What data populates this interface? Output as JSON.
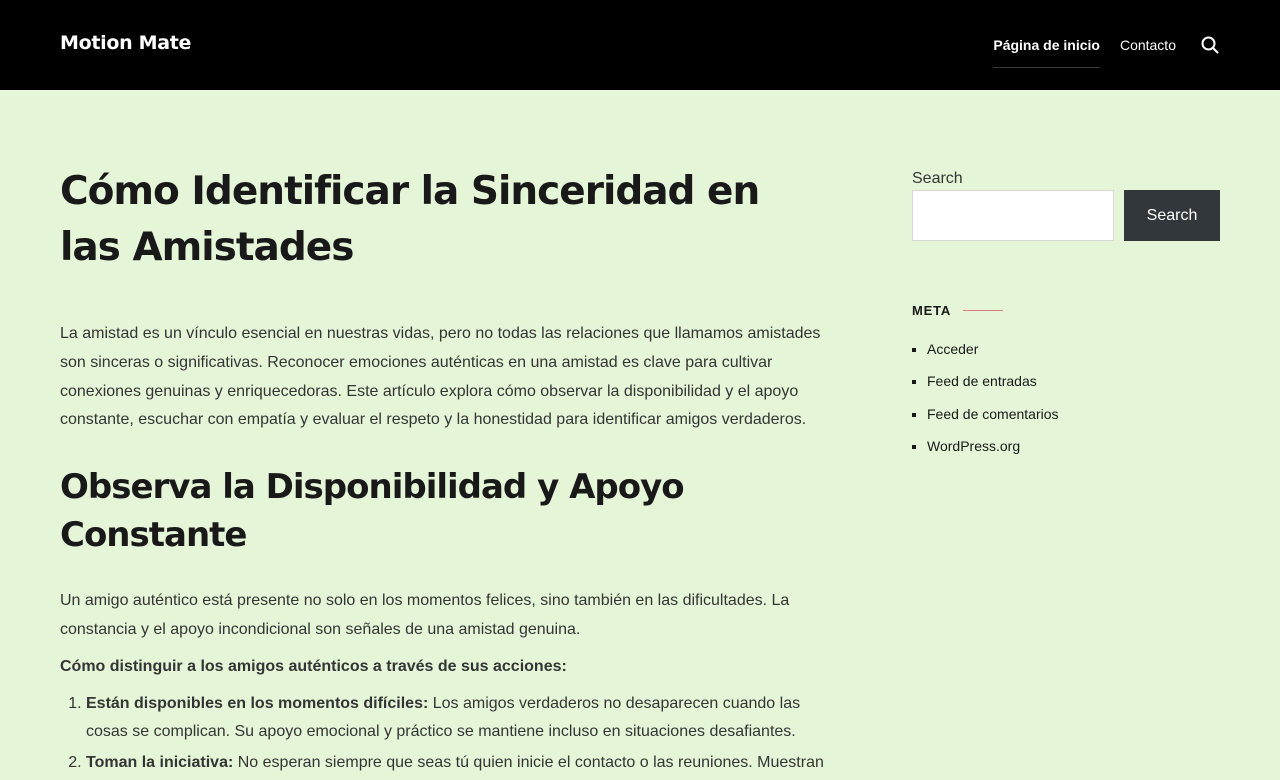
{
  "header": {
    "site_title": "Motion Mate",
    "nav": [
      {
        "label": "Página de inicio",
        "current": true
      },
      {
        "label": "Contacto",
        "current": false
      }
    ],
    "search_icon": "search-icon"
  },
  "main": {
    "title": "Cómo Identificar la Sinceridad en las Amistades",
    "intro": "La amistad es un vínculo esencial en nuestras vidas, pero no todas las relaciones que llamamos amistades son sinceras o significativas. Reconocer emociones auténticas en una amistad es clave para cultivar conexiones genuinas y enriquecedoras. Este artículo explora cómo observar la disponibilidad y el apoyo constante, escuchar con empatía y evaluar el respeto y la honestidad para identificar amigos verdaderos.",
    "section1_heading": "Observa la Disponibilidad y Apoyo Constante",
    "section1_para": "Un amigo auténtico está presente no solo en los momentos felices, sino también en las dificultades. La constancia y el apoyo incondicional son señales de una amistad genuina.",
    "section1_subheading": "Cómo distinguir a los amigos auténticos a través de sus acciones:",
    "list": [
      {
        "bold": "Están disponibles en los momentos difíciles:",
        "text": " Los amigos verdaderos no desaparecen cuando las cosas se complican. Su apoyo emocional y práctico se mantiene incluso en situaciones desafiantes."
      },
      {
        "bold": "Toman la iniciativa:",
        "text": " No esperan siempre que seas tú quien inicie el contacto o las reuniones. Muestran"
      }
    ]
  },
  "sidebar": {
    "search_label": "Search",
    "search_button": "Search",
    "search_value": "",
    "meta_title": "META",
    "meta_links": [
      "Acceder",
      "Feed de entradas",
      "Feed de comentarios",
      "WordPress.org"
    ]
  },
  "colors": {
    "header_bg": "#000000",
    "page_bg": "#e5f6d8",
    "button_bg": "#32373c",
    "accent_line": "#e07b7b"
  }
}
